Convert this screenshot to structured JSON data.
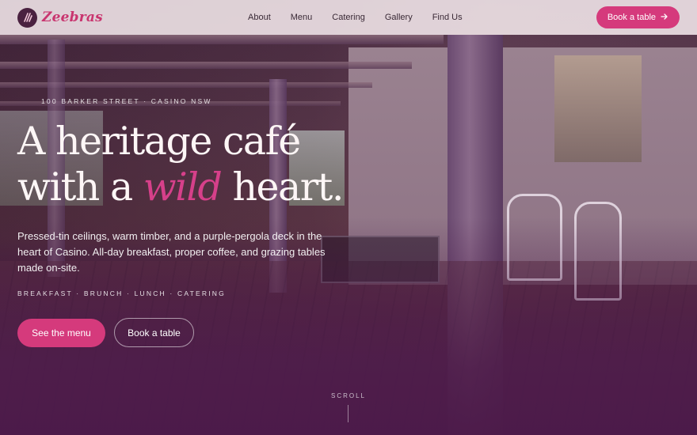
{
  "brand": {
    "name": "Zeebras",
    "logo_icon": "zebra-stripes-icon"
  },
  "nav": {
    "links": [
      "About",
      "Menu",
      "Catering",
      "Gallery",
      "Find Us"
    ],
    "cta_label": "Book a table",
    "cta_icon": "arrow-right-icon"
  },
  "hero": {
    "eyebrow": "100 BARKER STREET · CASINO NSW",
    "headline_line1": "A heritage café",
    "headline_line2_pre": "with a ",
    "headline_accent": "wild",
    "headline_line2_post": " heart.",
    "description": "Pressed-tin ceilings, warm timber, and a purple-pergola deck in the heart of Casino. All-day breakfast, proper coffee, and grazing tables made on-site.",
    "tags": "BREAKFAST · BRUNCH · LUNCH · CATERING",
    "primary_button": "See the menu",
    "secondary_button": "Book a table",
    "scroll_label": "SCROLL"
  },
  "colors": {
    "accent": "#d53a7c",
    "brand_text": "#c9356f",
    "nav_bg": "#f4e8ec",
    "logo_bg": "#4a2140"
  }
}
